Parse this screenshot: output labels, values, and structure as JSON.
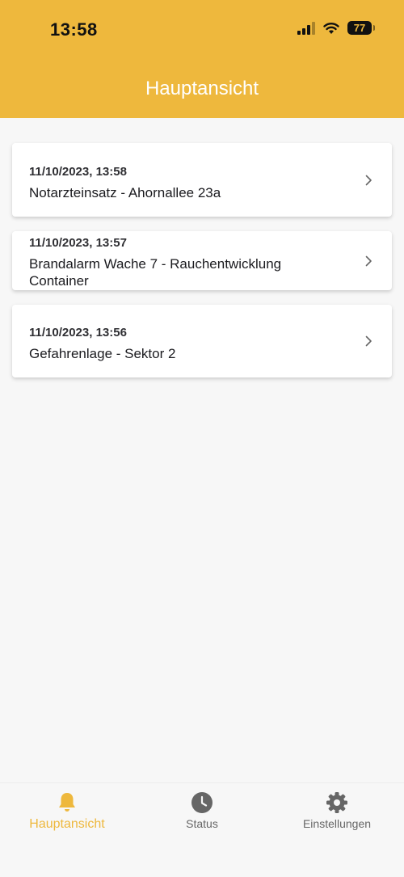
{
  "status_bar": {
    "time": "13:58",
    "battery": "77"
  },
  "header": {
    "title": "Hauptansicht"
  },
  "alerts": [
    {
      "date": "11/10/2023, 13:58",
      "title": "Notarzteinsatz - Ahornallee 23a"
    },
    {
      "date": "11/10/2023, 13:57",
      "title": "Brandalarm Wache 7 - Rauchentwicklung Container"
    },
    {
      "date": "11/10/2023, 13:56",
      "title": "Gefahrenlage - Sektor 2"
    }
  ],
  "tabs": [
    {
      "label": "Hauptansicht",
      "icon": "bell-icon",
      "active": true
    },
    {
      "label": "Status",
      "icon": "clock-icon",
      "active": false
    },
    {
      "label": "Einstellungen",
      "icon": "gear-icon",
      "active": false
    }
  ],
  "colors": {
    "accent": "#eeb83d",
    "background": "#f7f7f7",
    "inactive_tab": "#666666"
  }
}
